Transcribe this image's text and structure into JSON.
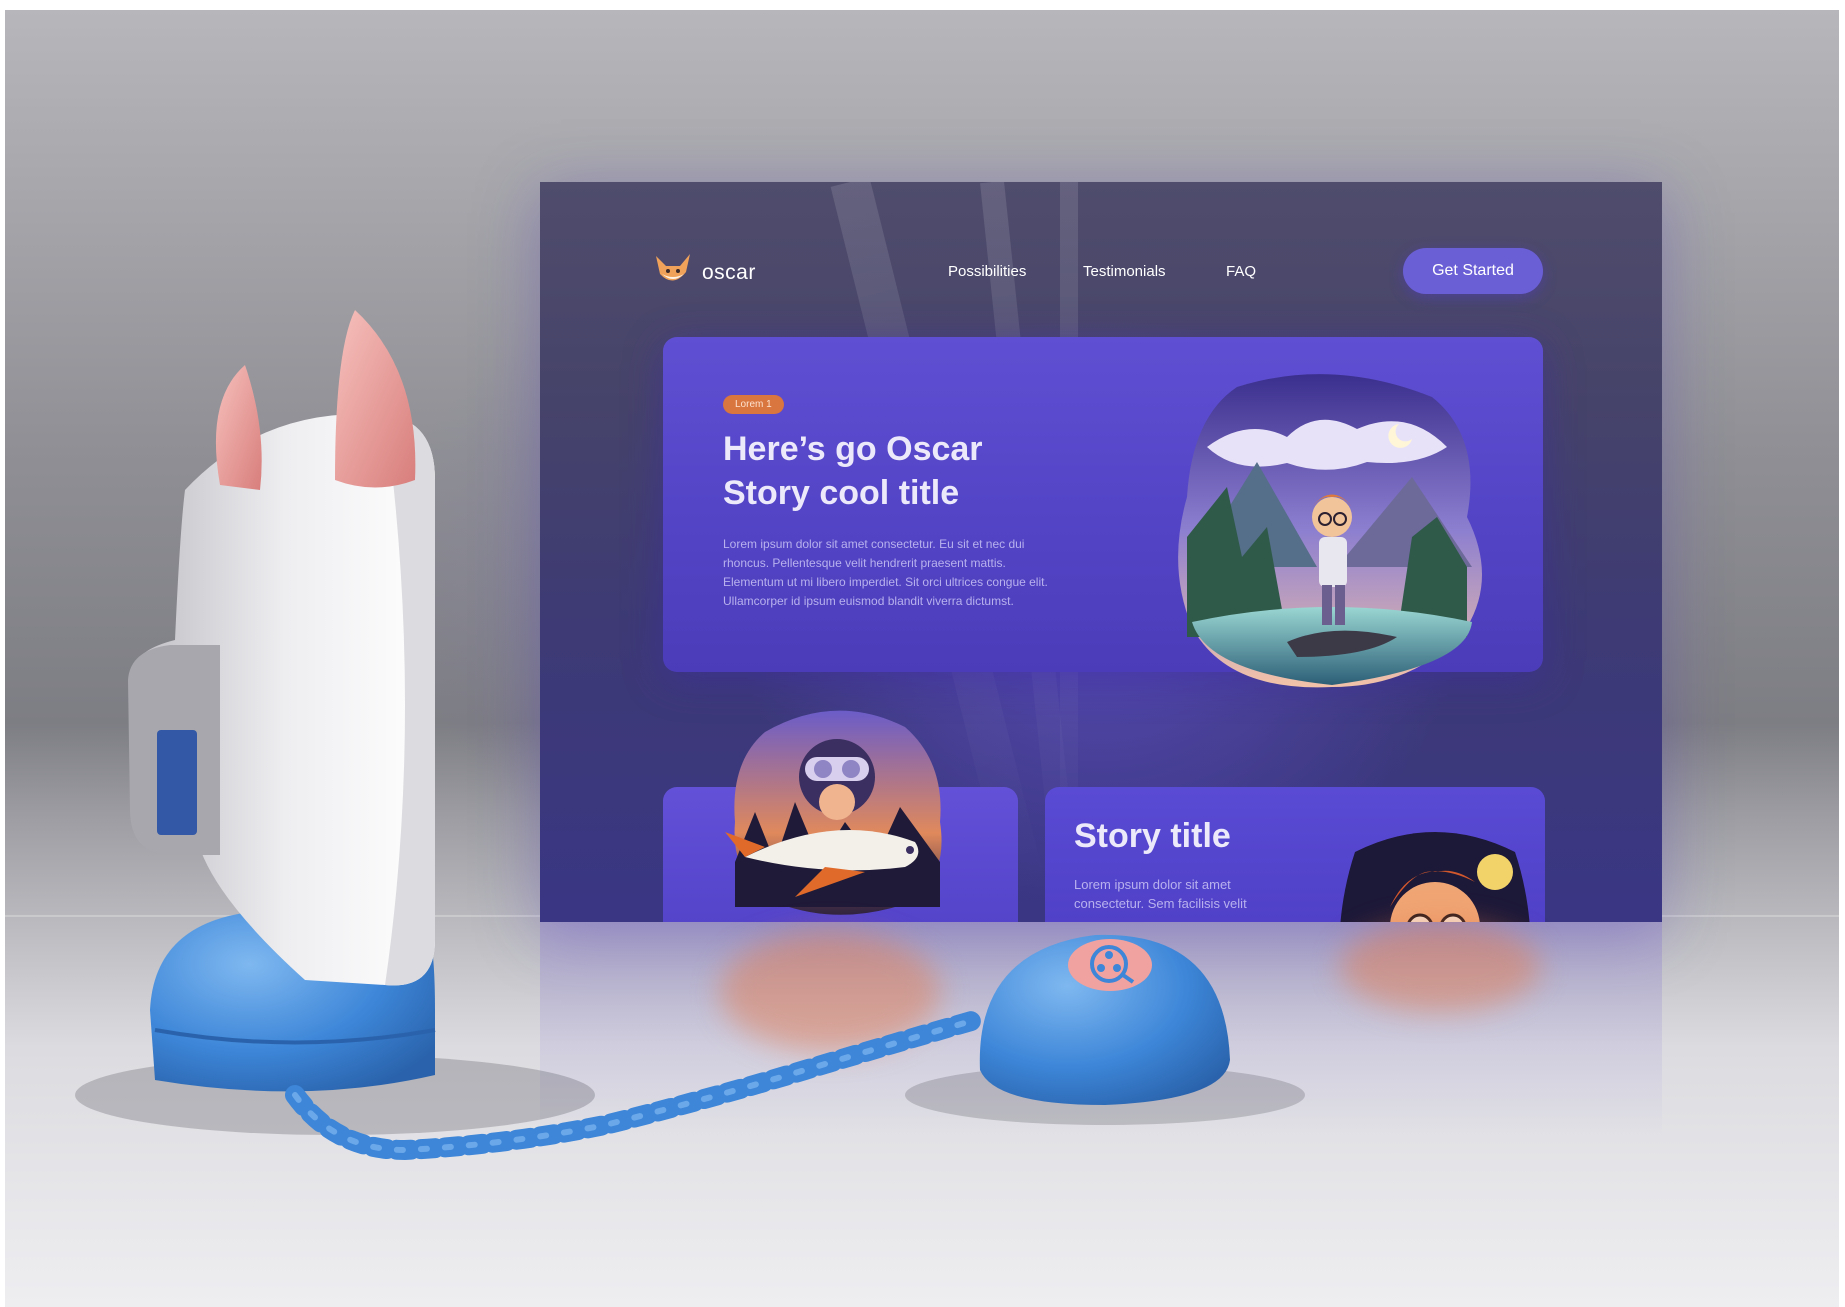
{
  "website": {
    "logo": {
      "text": "oscar",
      "icon": "fox-logo-icon"
    },
    "nav": {
      "links": [
        "Possibilities",
        "Testimonials",
        "FAQ"
      ],
      "cta_label": "Get Started"
    },
    "hero": {
      "badge": "Lorem 1",
      "title_line1": "Here’s go Oscar",
      "title_line2": "Story cool title",
      "body": "Lorem ipsum dolor sit amet consectetur. Eu sit et nec dui rhoncus. Pellentesque velit hendrerit praesent mattis. Elementum ut mi libero imperdiet. Sit orci ultrices congue elit. Ullamcorper id ipsum euismod blandit viverra dictumst."
    },
    "story_card": {
      "title": "Story title",
      "body": "Lorem ipsum dolor sit amet consectetur. Sem facilisis velit"
    }
  },
  "device": {
    "button_icon": "film-reel-icon"
  },
  "colors": {
    "accent": "#6b5fd6",
    "badge": "#d9753f",
    "device_blue": "#4a8fdc",
    "device_pink": "#f0a2a0"
  }
}
